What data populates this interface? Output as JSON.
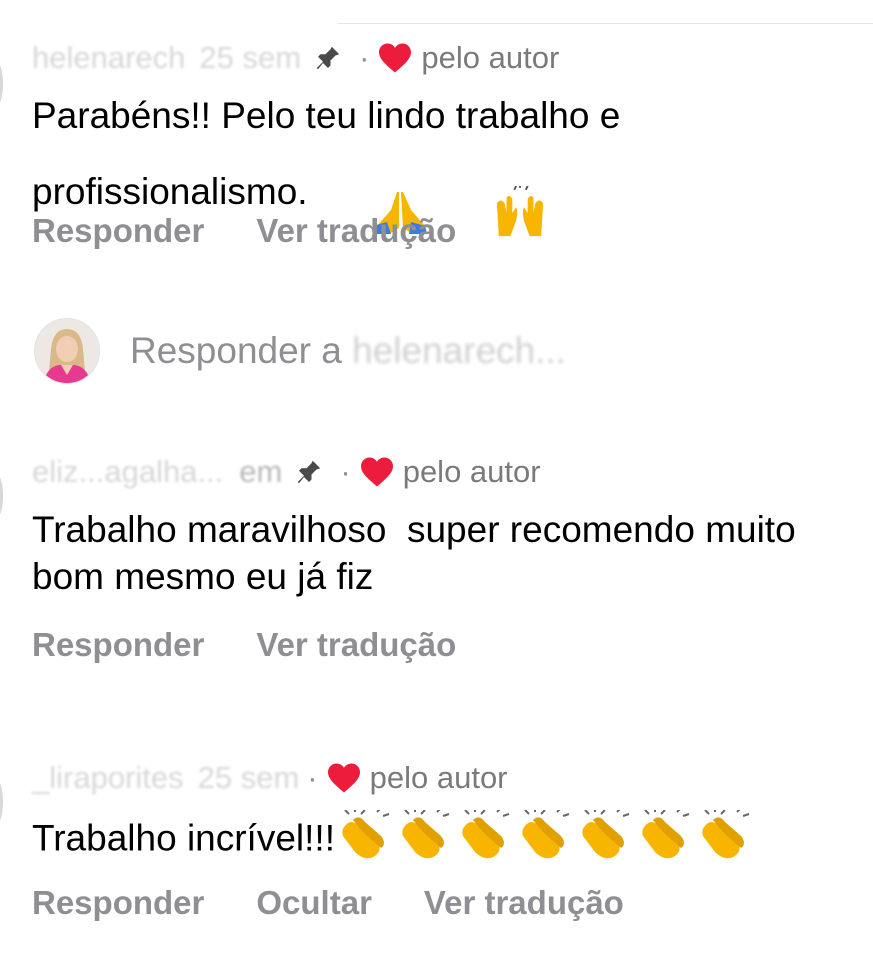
{
  "comments": [
    {
      "username": "helenarech",
      "time": "25 sem",
      "pinned": true,
      "liked_by_author": "pelo autor",
      "text": "Parabéns!! Pelo teu lindo trabalho e profissionalismo.",
      "actions": [
        "Responder",
        "Ver tradução"
      ]
    },
    {
      "username": "eliz...agalha...",
      "time": "em",
      "pinned": true,
      "liked_by_author": "pelo autor",
      "text": "Trabalho maravilhoso  super recomendo muito bom mesmo eu já fiz",
      "actions": [
        "Responder",
        "Ver tradução"
      ]
    },
    {
      "username": "_liraporites",
      "time": "25 sem",
      "pinned": false,
      "liked_by_author": "pelo autor",
      "text": "Trabalho incrível!!!",
      "actions": [
        "Responder",
        "Ocultar",
        "Ver tradução"
      ]
    }
  ],
  "reply_box": {
    "placeholder_prefix": "Responder a",
    "placeholder_name": "helenarech..."
  },
  "colors": {
    "heart": "#ed1c3c",
    "meta_gray": "#7a7a7a",
    "action_gray": "#8e8e93"
  },
  "icons": [
    "pin-icon",
    "heart-icon",
    "folded-hands-emoji",
    "raised-hands-emoji",
    "clapping-hands-emoji"
  ]
}
